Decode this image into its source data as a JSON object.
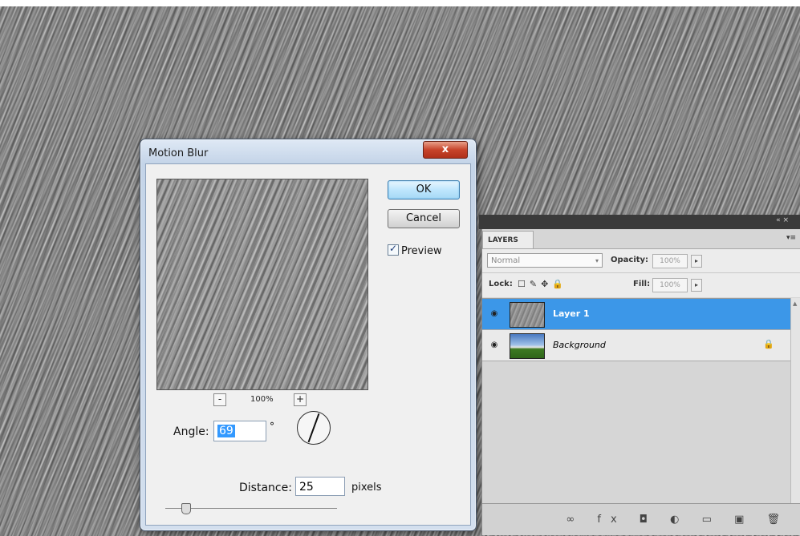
{
  "dialog": {
    "title": "Motion Blur",
    "close_glyph": "x",
    "ok_label": "OK",
    "cancel_label": "Cancel",
    "preview_label": "Preview",
    "preview_checked": true,
    "zoom_minus": "-",
    "zoom_plus": "+",
    "zoom_level": "100%",
    "angle_label": "Angle:",
    "angle_value": "69",
    "degree_symbol": "°",
    "distance_label": "Distance:",
    "distance_value": "25",
    "distance_unit": "pixels"
  },
  "layers_panel": {
    "collapse_glyph": "« ×",
    "tab_label": "LAYERS",
    "menu_glyph": "▾≡",
    "blend_mode": "Normal",
    "opacity_label": "Opacity:",
    "opacity_value": "100%",
    "lock_label": "Lock:",
    "lock_icons": "☐✎✥🔒",
    "fill_label": "Fill:",
    "fill_value": "100%",
    "arrow_glyph": "▸",
    "dropdown_glyph": "▾",
    "eye_glyph": "◉",
    "lock_glyph": "🔒",
    "scroll_up_glyph": "▲",
    "bottom_icons": "∞ fx ◘ ◐ ▭ ▣ 🗑",
    "layers": [
      {
        "name": "Layer 1",
        "selected": true
      },
      {
        "name": "Background",
        "selected": false,
        "locked": true
      }
    ]
  }
}
